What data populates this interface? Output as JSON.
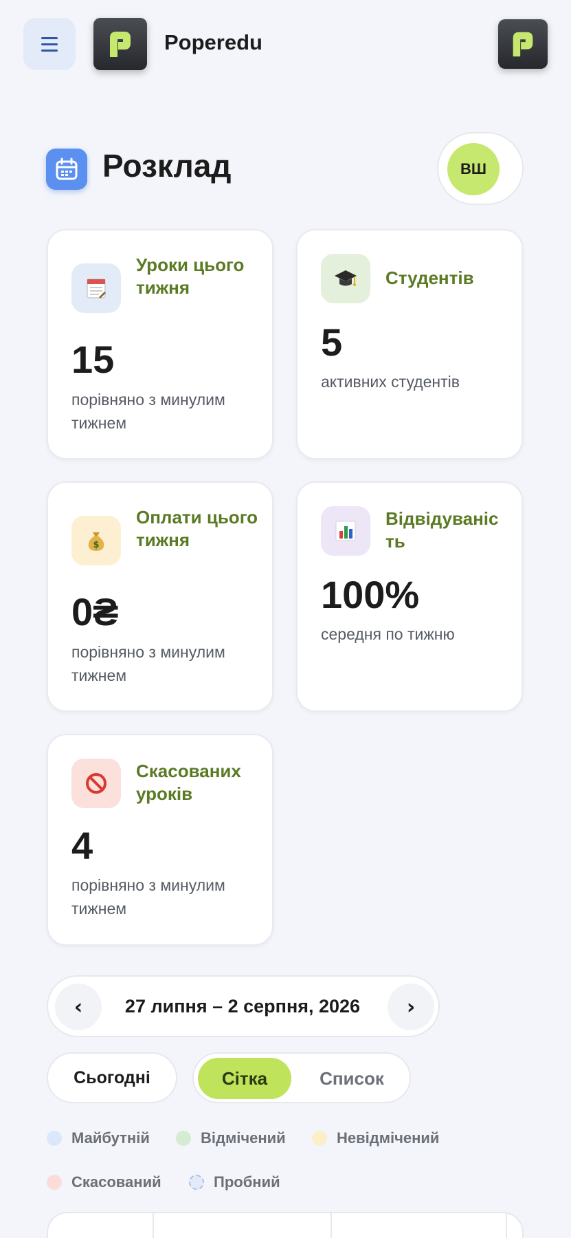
{
  "header": {
    "app_name": "Poperedu",
    "menu_icon": "hamburger-menu-icon",
    "logo_icon": "poperedu-logo-icon"
  },
  "page": {
    "title": "Розклад",
    "title_icon": "calendar-icon",
    "avatar_initials": "ВШ"
  },
  "stats": [
    {
      "title": "Уроки цього тижня",
      "value": "15",
      "subtitle": "порівняно з минулим тижнем",
      "icon": "calendar-pad-icon",
      "icon_bg": "#e3ebf8"
    },
    {
      "title": "Студентів",
      "value": "5",
      "subtitle": "активних студентів",
      "icon": "graduation-cap-icon",
      "icon_bg": "#e4f0dc"
    },
    {
      "title": "Оплати цього тижня",
      "value": "0₴",
      "subtitle": "порівняно з минулим тижнем",
      "icon": "money-bag-icon",
      "icon_bg": "#fdf0d2"
    },
    {
      "title": "Відвідуваність",
      "value": "100%",
      "subtitle": "середня по тижню",
      "icon": "bar-chart-icon",
      "icon_bg": "#ede6f7"
    },
    {
      "title": "Скасованих уроків",
      "value": "4",
      "subtitle": "порівняно з минулим тижнем",
      "icon": "prohibited-icon",
      "icon_bg": "#fbe0dc"
    }
  ],
  "week_nav": {
    "prev": "‹",
    "next": "›",
    "range": "27 липня – 2 серпня, 2026"
  },
  "controls": {
    "today": "Сьогодні",
    "view_grid": "Сітка",
    "view_list": "Список",
    "active_view": "Сітка"
  },
  "legend": [
    {
      "label": "Майбутній",
      "color": "#dbe8fb"
    },
    {
      "label": "Відмічений",
      "color": "#d5ecd2"
    },
    {
      "label": "Невідмічений",
      "color": "#fcefc8"
    },
    {
      "label": "Скасований",
      "color": "#fbdcd8"
    },
    {
      "label": "Пробний",
      "color": "#e3ebf8"
    }
  ],
  "colors": {
    "accent_green": "#bfe35a",
    "title_green": "#5a7a24",
    "background": "#f3f5fa"
  }
}
